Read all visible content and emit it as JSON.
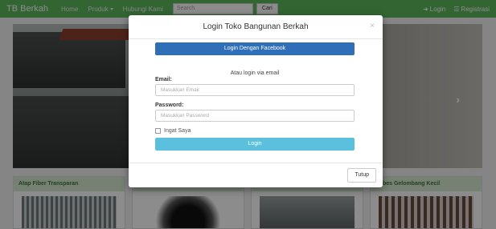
{
  "navbar": {
    "brand": "TB Berkah",
    "links": [
      "Home",
      "Produk",
      "Hubungi Kami"
    ],
    "search_placeholder": "Search",
    "search_button": "Cari",
    "login": "Login",
    "register": "Registrasi"
  },
  "carousel": {
    "next_icon": "chevron-right-icon"
  },
  "products": [
    {
      "title": "Atap Fiber Transparan"
    },
    {
      "title": ""
    },
    {
      "title": ""
    },
    {
      "title": "Asbes Gelombang Kecil"
    }
  ],
  "modal": {
    "title": "Login Toko Bangunan Berkah",
    "close_icon": "×",
    "facebook_button": "Login Dengan Facebook",
    "or_text": "Atau login via email",
    "email_label": "Email:",
    "email_placeholder": "Masukkan Email",
    "password_label": "Password:",
    "password_placeholder": "Masukkan Password",
    "remember_label": "Ingat Saya",
    "login_button": "Login",
    "close_button": "Tutup"
  },
  "colors": {
    "navbar": "#5cb85c",
    "facebook": "#2f6fb7",
    "login": "#5bc0de",
    "product_header": "#d7ecd2"
  }
}
